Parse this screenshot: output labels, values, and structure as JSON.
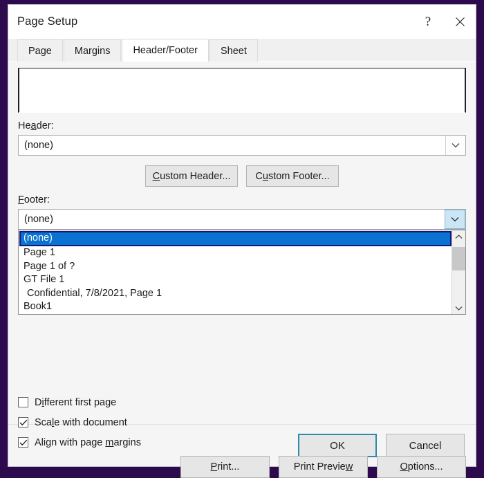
{
  "window": {
    "title": "Page Setup",
    "help_icon": "question-mark-icon",
    "close_icon": "close-icon"
  },
  "tabs": [
    {
      "label": "Page",
      "active": false
    },
    {
      "label": "Margins",
      "active": false
    },
    {
      "label": "Header/Footer",
      "active": true
    },
    {
      "label": "Sheet",
      "active": false
    }
  ],
  "header_section": {
    "label_pre": "He",
    "label_acc": "a",
    "label_post": "der:",
    "value": "(none)",
    "arrow_icon": "chevron-down-icon"
  },
  "custom_buttons": {
    "header": {
      "pre": "",
      "acc": "C",
      "post": "ustom Header..."
    },
    "footer": {
      "pre": "C",
      "acc": "u",
      "post": "stom Footer..."
    }
  },
  "footer_section": {
    "label_pre": "",
    "label_acc": "F",
    "label_post": "ooter:",
    "value": "(none)",
    "arrow_icon": "chevron-down-icon"
  },
  "dropdown": {
    "scroll_up_icon": "chevron-up-icon",
    "scroll_down_icon": "chevron-down-icon",
    "items": [
      {
        "label": "(none)",
        "selected": true,
        "indent": false
      },
      {
        "label": "Page 1",
        "selected": false,
        "indent": false
      },
      {
        "label": "Page 1 of ?",
        "selected": false,
        "indent": false
      },
      {
        "label": "GT File 1",
        "selected": false,
        "indent": false
      },
      {
        "label": "Confidential, 7/8/2021, Page 1",
        "selected": false,
        "indent": true
      },
      {
        "label": "Book1",
        "selected": false,
        "indent": false
      }
    ]
  },
  "checkboxes": [
    {
      "pre": "D",
      "acc": "i",
      "post": "fferent first page",
      "checked": false,
      "name": "different-first-page"
    },
    {
      "pre": "Sca",
      "acc": "l",
      "post": "e with document",
      "checked": true,
      "name": "scale-with-document"
    },
    {
      "pre": "Align with page ",
      "acc": "m",
      "post": "argins",
      "checked": true,
      "name": "align-with-page-margins"
    }
  ],
  "action_buttons": [
    {
      "pre": "",
      "acc": "P",
      "post": "rint...",
      "name": "print-button"
    },
    {
      "pre": "Print Previe",
      "acc": "w",
      "post": "",
      "name": "print-preview-button"
    },
    {
      "pre": "",
      "acc": "O",
      "post": "ptions...",
      "name": "options-button"
    }
  ],
  "footer_buttons": {
    "ok": "OK",
    "cancel": "Cancel"
  },
  "colors": {
    "backdrop_purple": "#2d0a4e",
    "selection_blue": "#0a72d0",
    "selection_border": "#161678",
    "focus_teal": "#2e8aa8",
    "active_arrow_blue": "#cbe5f5"
  }
}
